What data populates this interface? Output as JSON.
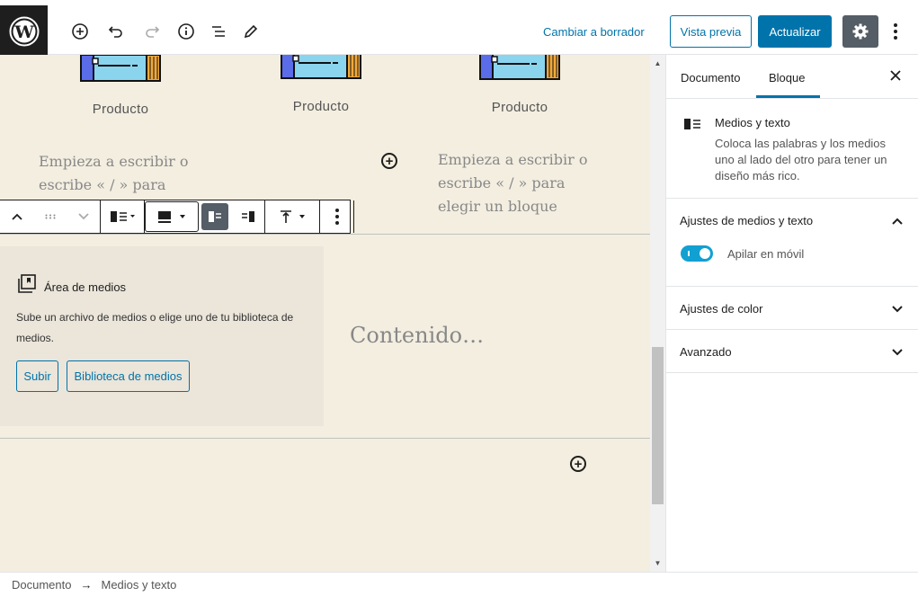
{
  "topbar": {
    "switch_to_draft": "Cambiar a borrador",
    "preview": "Vista previa",
    "update": "Actualizar"
  },
  "canvas": {
    "products": [
      "Producto",
      "Producto",
      "Producto"
    ],
    "paragraph_placeholder_left": "Empieza a escribir o escribe « / » para elegir",
    "paragraph_placeholder_right": "Empieza a escribir o escribe « / » para elegir un bloque",
    "media_area": {
      "title": "Área de medios",
      "description": "Sube un archivo de medios o elige uno de tu biblioteca de medios.",
      "upload_button": "Subir",
      "library_button": "Biblioteca de medios"
    },
    "content_placeholder": "Contenido…"
  },
  "sidebar": {
    "tabs": [
      "Documento",
      "Bloque"
    ],
    "active_tab": "Bloque",
    "block": {
      "title": "Medios y texto",
      "description": "Coloca las palabras y los medios uno al lado del otro para tener un diseño más rico."
    },
    "panels": [
      {
        "title": "Ajustes de medios y texto",
        "expanded": true,
        "toggle_label": "Apilar en móvil",
        "toggle_on": true
      },
      {
        "title": "Ajustes de color",
        "expanded": false
      },
      {
        "title": "Avanzado",
        "expanded": false
      }
    ]
  },
  "breadcrumb": [
    "Documento",
    "Medios y texto"
  ],
  "colors": {
    "accent": "#0073aa",
    "canvas_bg": "#f3eee0",
    "toggle_on": "#11a0d2",
    "dark": "#1e1e1e"
  }
}
